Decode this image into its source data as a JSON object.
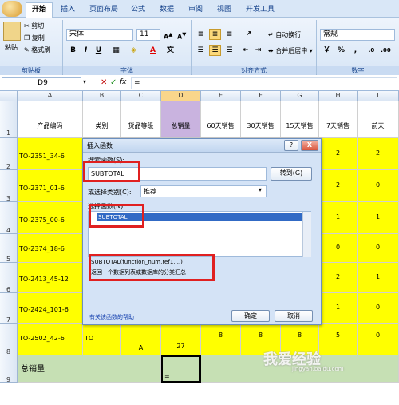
{
  "ribbon": {
    "tabs": [
      "开始",
      "插入",
      "页面布局",
      "公式",
      "数据",
      "审阅",
      "视图",
      "开发工具"
    ],
    "clipboard": {
      "paste": "粘贴",
      "cut": "剪切",
      "copy": "复制",
      "format_painter": "格式刷",
      "label": "剪贴板"
    },
    "font": {
      "name": "宋体",
      "size": "11",
      "bold": "B",
      "italic": "I",
      "underline": "U",
      "label": "字体"
    },
    "alignment": {
      "wrap": "自动换行",
      "merge": "合并后居中",
      "label": "对齐方式"
    },
    "number": {
      "format": "常规",
      "label": "数字",
      "currency": "%",
      "percent": "%",
      "comma": ","
    }
  },
  "formula_bar": {
    "name_box": "D9",
    "fx": "fx",
    "value": "="
  },
  "columns": [
    "A",
    "B",
    "C",
    "D",
    "E",
    "F",
    "G",
    "H",
    "I"
  ],
  "rows": [
    "1",
    "2",
    "3",
    "4",
    "5",
    "6",
    "7",
    "8",
    "9"
  ],
  "header_row": [
    "产品编码",
    "类别",
    "货品等级",
    "总销量",
    "60天销售",
    "30天销售",
    "15天销售",
    "7天销售",
    "前天"
  ],
  "product_codes": [
    "TO-2351_34-6",
    "TO-2371_01-6",
    "TO-2375_00-6",
    "TO-2374_18-6",
    "TO-2413_45-12",
    "TO-2424_101-6",
    "TO-2502_42-6"
  ],
  "h_col": [
    "2",
    "2",
    "1",
    "0",
    "2",
    "1",
    "5"
  ],
  "i_col": [
    "2",
    "0",
    "1",
    "0",
    "1",
    "0",
    "0"
  ],
  "row8": {
    "b": "TO",
    "c": "A",
    "d": "27",
    "e": "8",
    "f": "8",
    "g": "8"
  },
  "row9": {
    "label": "总销量",
    "d": "="
  },
  "dialog": {
    "title": "插入函数",
    "search_label": "搜索函数(S):",
    "search_value": "SUBTOTAL",
    "goto_button": "转到(G)",
    "category_label": "或选择类别(C):",
    "category_value": "推荐",
    "select_label": "选择函数(N):",
    "selected_function": "SUBTOTAL",
    "syntax": "SUBTOTAL(function_num,ref1,...)",
    "description": "返回一个数据列表或数据库的分类汇总",
    "help_link": "有关该函数的帮助",
    "ok": "确定",
    "cancel": "取消",
    "help_btn": "?",
    "close_btn": "X"
  },
  "watermark": {
    "text": "我爱经验",
    "url": "jingyan.baidu.com"
  },
  "colors": {
    "accent": "#15428b",
    "highlight": "#ffff00",
    "selection": "#316ac5",
    "red_box": "#e02020"
  }
}
